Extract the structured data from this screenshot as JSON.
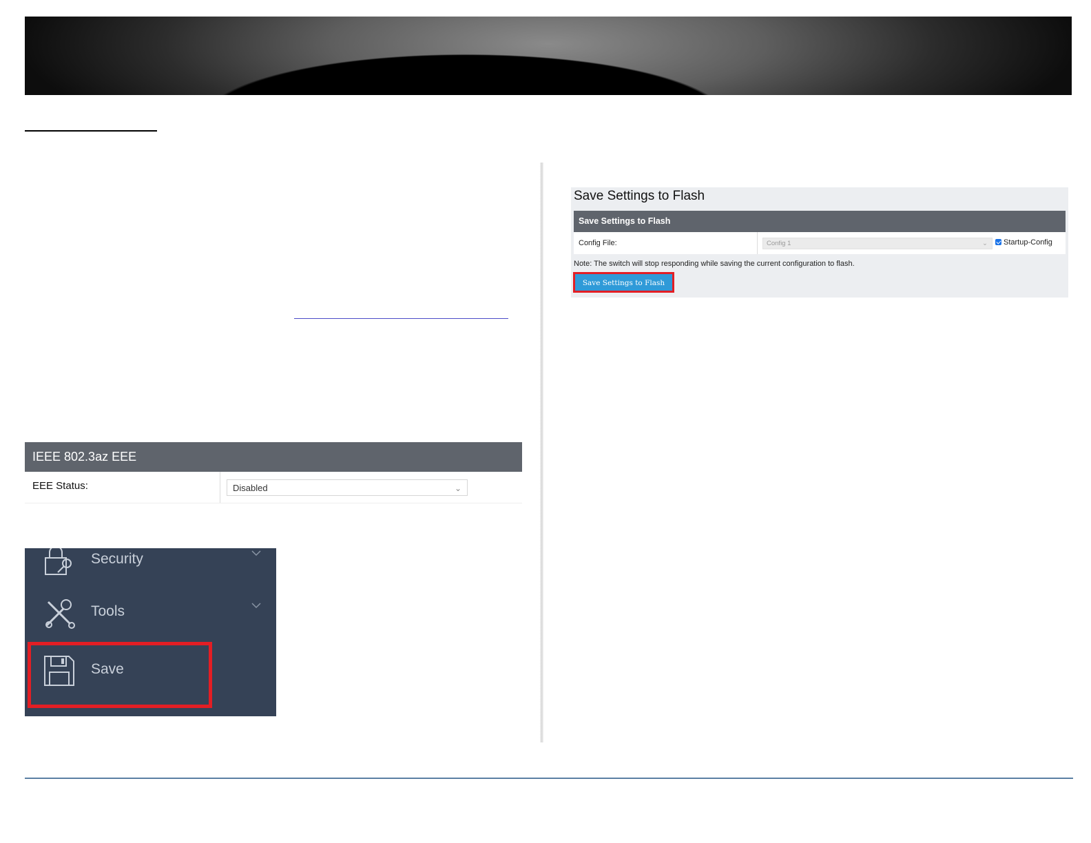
{
  "eee_panel": {
    "header": "IEEE 802.3az EEE",
    "status_label": "EEE Status:",
    "status_value": "Disabled"
  },
  "sidebar": {
    "items": [
      {
        "label": "Security",
        "icon": "lock-icon"
      },
      {
        "label": "Tools",
        "icon": "tools-icon"
      },
      {
        "label": "Save",
        "icon": "floppy-disk-icon"
      }
    ]
  },
  "flash_panel": {
    "page_title": "Save Settings to Flash",
    "section_header": "Save Settings to Flash",
    "config_file_label": "Config File:",
    "config_file_value": "Config 1",
    "startup_config_label": "Startup-Config",
    "startup_config_checked": true,
    "note": "Note: The switch will stop responding while saving the current configuration to flash.",
    "button_label": "Save Settings to Flash"
  },
  "colors": {
    "highlight": "#e31e24",
    "panel_header": "#5f646c",
    "sidebar_bg": "#354256",
    "button": "#2f9ad8",
    "footer_rule": "#5a7fa3"
  }
}
